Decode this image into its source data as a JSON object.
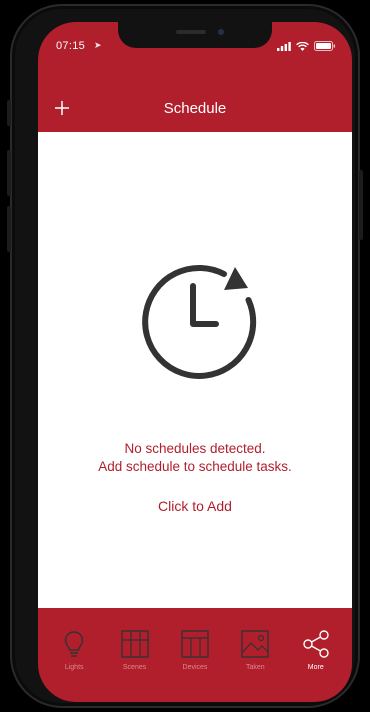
{
  "status_bar": {
    "time": "07:15"
  },
  "header": {
    "title": "Schedule"
  },
  "empty_state": {
    "line1": "No schedules detected.",
    "line2": "Add schedule to schedule tasks.",
    "action": "Click to Add"
  },
  "tabs": [
    {
      "label": "Lights",
      "icon": "bulb-icon",
      "active": false
    },
    {
      "label": "Scenes",
      "icon": "scenes-icon",
      "active": false
    },
    {
      "label": "Devices",
      "icon": "devices-icon",
      "active": false
    },
    {
      "label": "Taken",
      "icon": "photo-icon",
      "active": false
    },
    {
      "label": "More",
      "icon": "share-icon",
      "active": true
    }
  ],
  "colors": {
    "accent": "#b11e2c",
    "content_bg": "#ffffff",
    "icon_gray": "#333333"
  }
}
